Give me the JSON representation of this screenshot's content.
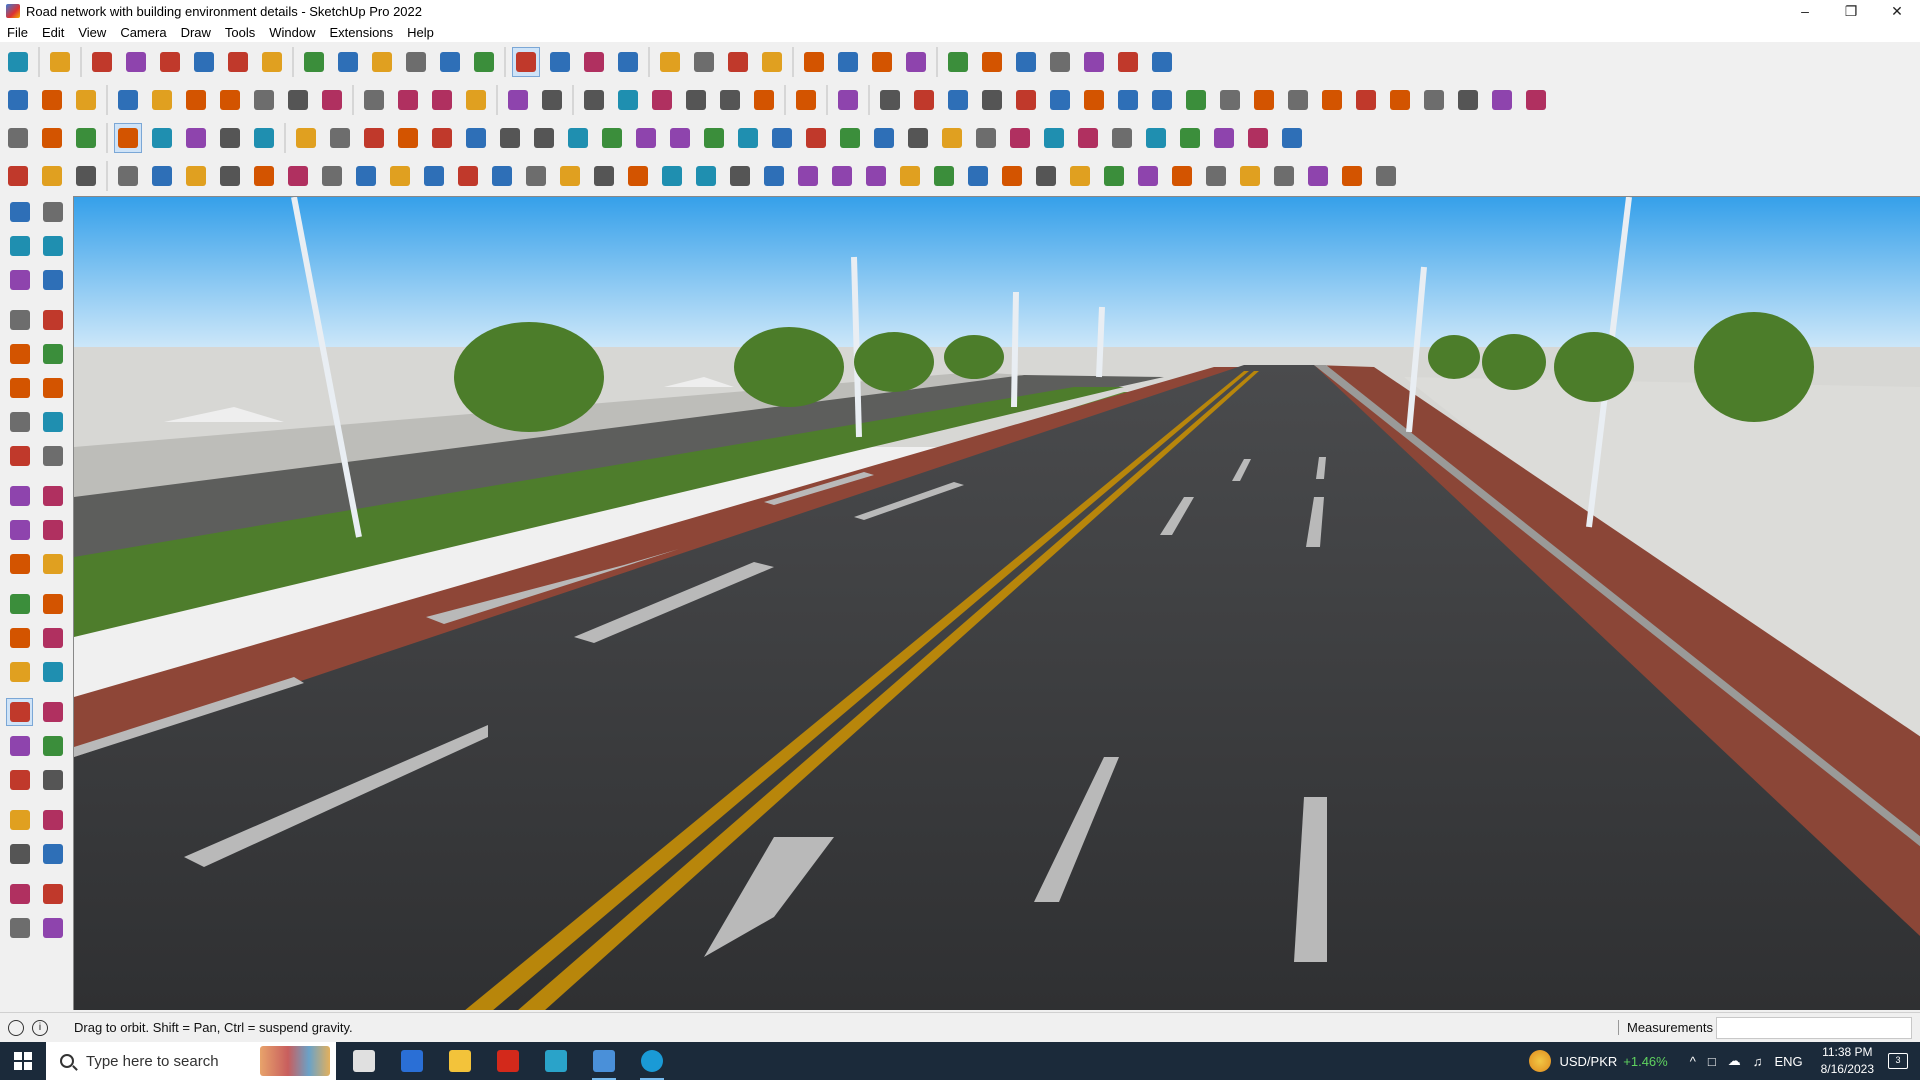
{
  "window": {
    "title": "Road network with building environment details - SketchUp Pro 2022",
    "controls": {
      "minimize": "–",
      "restore": "❐",
      "close": "✕"
    }
  },
  "menu": {
    "items": [
      "File",
      "Edit",
      "View",
      "Camera",
      "Draw",
      "Tools",
      "Window",
      "Extensions",
      "Help"
    ]
  },
  "toolbars": {
    "row1": [
      "zoom-icon",
      "select-icon",
      "eraser-icon",
      "pencil-line-icon",
      "lasso-icon",
      "rectangle-icon",
      "push-pull-icon",
      "follow-me-icon",
      "move-icon",
      "rotate-icon",
      "scale-icon",
      "tape-measure-icon",
      "text-icon",
      "paint-bucket-icon",
      "orbit-icon",
      "pan-icon",
      "zoom-window-icon",
      "zoom-extents-icon",
      "components-icon",
      "sandbox-icon",
      "layers-icon",
      "styles-icon",
      "user-icon",
      "warehouse-icon",
      "extension-warehouse-icon",
      "layout-icon",
      "flip-icon",
      "section-icon",
      "import-icon",
      "share-icon",
      "undo-icon",
      "redo-icon",
      "print-icon"
    ],
    "row2": [
      "cube-icon",
      "sphere-icon",
      "cylinder-icon",
      "move-up-icon",
      "cube-blue-icon",
      "cube-red-icon",
      "cube-green-icon",
      "cube-north-icon",
      "cube-orange-icon",
      "cube-pink-icon",
      "arc-tool-icon",
      "pipe-icon",
      "slash-blue-icon",
      "slash-purple-icon",
      "leaf-icon",
      "tree-icon",
      "house-a-icon",
      "house-b-icon",
      "house-c-icon",
      "roof-icon",
      "shed-icon",
      "garage-icon",
      "font-icon",
      "shell-icon",
      "measure-red-icon",
      "circle-a-icon",
      "circle-b-icon",
      "polygon-icon",
      "ellipse-icon",
      "spiral-icon",
      "parallelogram-icon",
      "arc-2-icon",
      "curve-icon",
      "wave-icon",
      "swirl-icon",
      "red-arrow-icon",
      "brush-pink-icon",
      "wood-a-icon",
      "grid-red-icon",
      "box-red-icon",
      "box-gray-icon",
      "bucket-icon",
      "box-dark-icon",
      "triangle-icon"
    ],
    "row3": [
      "blue-plane-icon",
      "blue-diamond-icon",
      "yellow-plane-icon",
      "active-tool-icon",
      "red-solid-icon",
      "red-plane-icon",
      "loop-icon",
      "red-square-icon",
      "stack-icon",
      "page-icon",
      "wood-plank-icon",
      "chain-icon",
      "arc-path-icon",
      "dotted-arc-icon",
      "red-cross-icon",
      "green-cross-icon",
      "blue-x-icon",
      "cone-icon",
      "fountain-icon",
      "warn-icon",
      "lasso-yellow-icon",
      "lasso-orange-icon",
      "orbit-ring-icon",
      "crosshair-icon",
      "bin-icon",
      "red-hook-icon",
      "green-bars-icon",
      "split-icon",
      "boxes-icon",
      "house-red-icon",
      "gem-icon",
      "grid-square-icon",
      "frame-icon",
      "orange-grid-icon",
      "yellow-grid-icon",
      "dots-icon",
      "dotted-curve-icon",
      "grid-dots-icon"
    ],
    "row4": [
      "polyline-icon",
      "dash-curve-icon",
      "car-icon",
      "fence-icon",
      "wire-a-icon",
      "wire-b-icon",
      "rope-icon",
      "loop-b-icon",
      "helix-icon",
      "bolt-icon",
      "stair-a-icon",
      "stair-b-icon",
      "slope-icon",
      "ramp-icon",
      "box-frame-icon",
      "slide-icon",
      "pylon-icon",
      "ribs-icon",
      "shell-b-icon",
      "spring-icon",
      "fold-icon",
      "star-frame-icon",
      "layers-b-icon",
      "slab-icon",
      "spike-icon",
      "fork-icon",
      "jagged-icon",
      "cabin-icon",
      "stripe-icon",
      "tower-icon",
      "arch-icon",
      "grid-a-icon",
      "grid-b-icon",
      "grid-c-icon",
      "grid-d-icon",
      "comb-icon",
      "wave-grid-icon",
      "dome-icon",
      "lattice-icon",
      "fan-icon",
      "arrow-box-icon"
    ]
  },
  "left_palette": [
    [
      "select-tool-icon",
      "orbit-tool-icon"
    ],
    [
      "paint-tool-icon",
      "eraser-tool-icon"
    ],
    [
      "component-tool-icon",
      "tag-tool-icon"
    ],
    [
      "gap"
    ],
    [
      "line-tool-icon",
      "freehand-tool-icon"
    ],
    [
      "rect-tool-icon",
      "rotated-rect-tool-icon"
    ],
    [
      "circle-tool-icon",
      "polygon-tool-icon"
    ],
    [
      "arc-tool-icon",
      "pie-tool-icon"
    ],
    [
      "arc3-tool-icon",
      "arc2-tool-icon"
    ],
    [
      "gap"
    ],
    [
      "move-tool-icon",
      "pushpull-tool-icon"
    ],
    [
      "rotate-tool-icon",
      "followme-tool-icon"
    ],
    [
      "scale-tool-icon",
      "offset-tool-icon"
    ],
    [
      "gap"
    ],
    [
      "tape-tool-icon",
      "dimension-tool-icon"
    ],
    [
      "protractor-tool-icon",
      "text-tool-icon"
    ],
    [
      "axes-tool-icon",
      "3dtext-tool-icon"
    ],
    [
      "gap"
    ],
    [
      "orbit-active-tool-icon",
      "pan-tool-icon"
    ],
    [
      "zoom-tool-icon",
      "zoom-window-tool-icon"
    ],
    [
      "zoom-extents-tool-icon",
      "prev-view-tool-icon"
    ],
    [
      "gap"
    ],
    [
      "position-camera-tool-icon",
      "look-around-tool-icon"
    ],
    [
      "walk-tool-icon",
      "section-plane-tool-icon"
    ],
    [
      "gap"
    ],
    [
      "warehouse-tool-icon",
      "extension-tool-icon"
    ],
    [
      "layers-tool-icon",
      "share-tool-icon"
    ]
  ],
  "status": {
    "hint": "Drag to orbit. Shift = Pan, Ctrl = suspend gravity.",
    "measurements_label": "Measurements",
    "measurements_value": ""
  },
  "taskbar": {
    "search_placeholder": "Type here to search",
    "apps": [
      "task-view-icon",
      "calculator-icon",
      "file-explorer-icon",
      "acrobat-icon",
      "sketchup-3d-icon",
      "sketchup-app-icon",
      "edge-icon"
    ],
    "ticker_name": "USD/PKR",
    "ticker_change": "+1.46%",
    "tray": [
      "^",
      "□",
      "☁",
      "♫"
    ],
    "language": "ENG",
    "time": "11:38 PM",
    "date": "8/16/2023"
  },
  "colors": {
    "sky_top": "#3aa0e6",
    "sky_bottom": "#d6ecfb",
    "asphalt": "#3b3c3e",
    "sidewalk": "#8e4637",
    "center_line": "#b8860b",
    "grass": "#4e7d2c"
  }
}
